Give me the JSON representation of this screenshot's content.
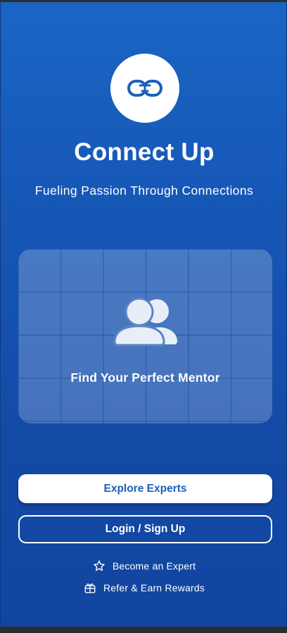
{
  "app": {
    "title": "Connect Up",
    "tagline": "Fueling Passion Through Connections",
    "logo_icon": "chain-link-icon"
  },
  "hero": {
    "label": "Find Your Perfect Mentor",
    "icon": "users-icon"
  },
  "actions": {
    "explore_label": "Explore Experts",
    "login_label": "Login / Sign Up"
  },
  "links": {
    "become_expert": "Become an Expert",
    "become_expert_icon": "star-icon",
    "refer": "Refer & Earn Rewards",
    "refer_icon": "gift-icon"
  },
  "colors": {
    "background_top": "#1a65c4",
    "background_bottom": "#1245a0",
    "primary_text_on_white": "#1d5fb8"
  }
}
